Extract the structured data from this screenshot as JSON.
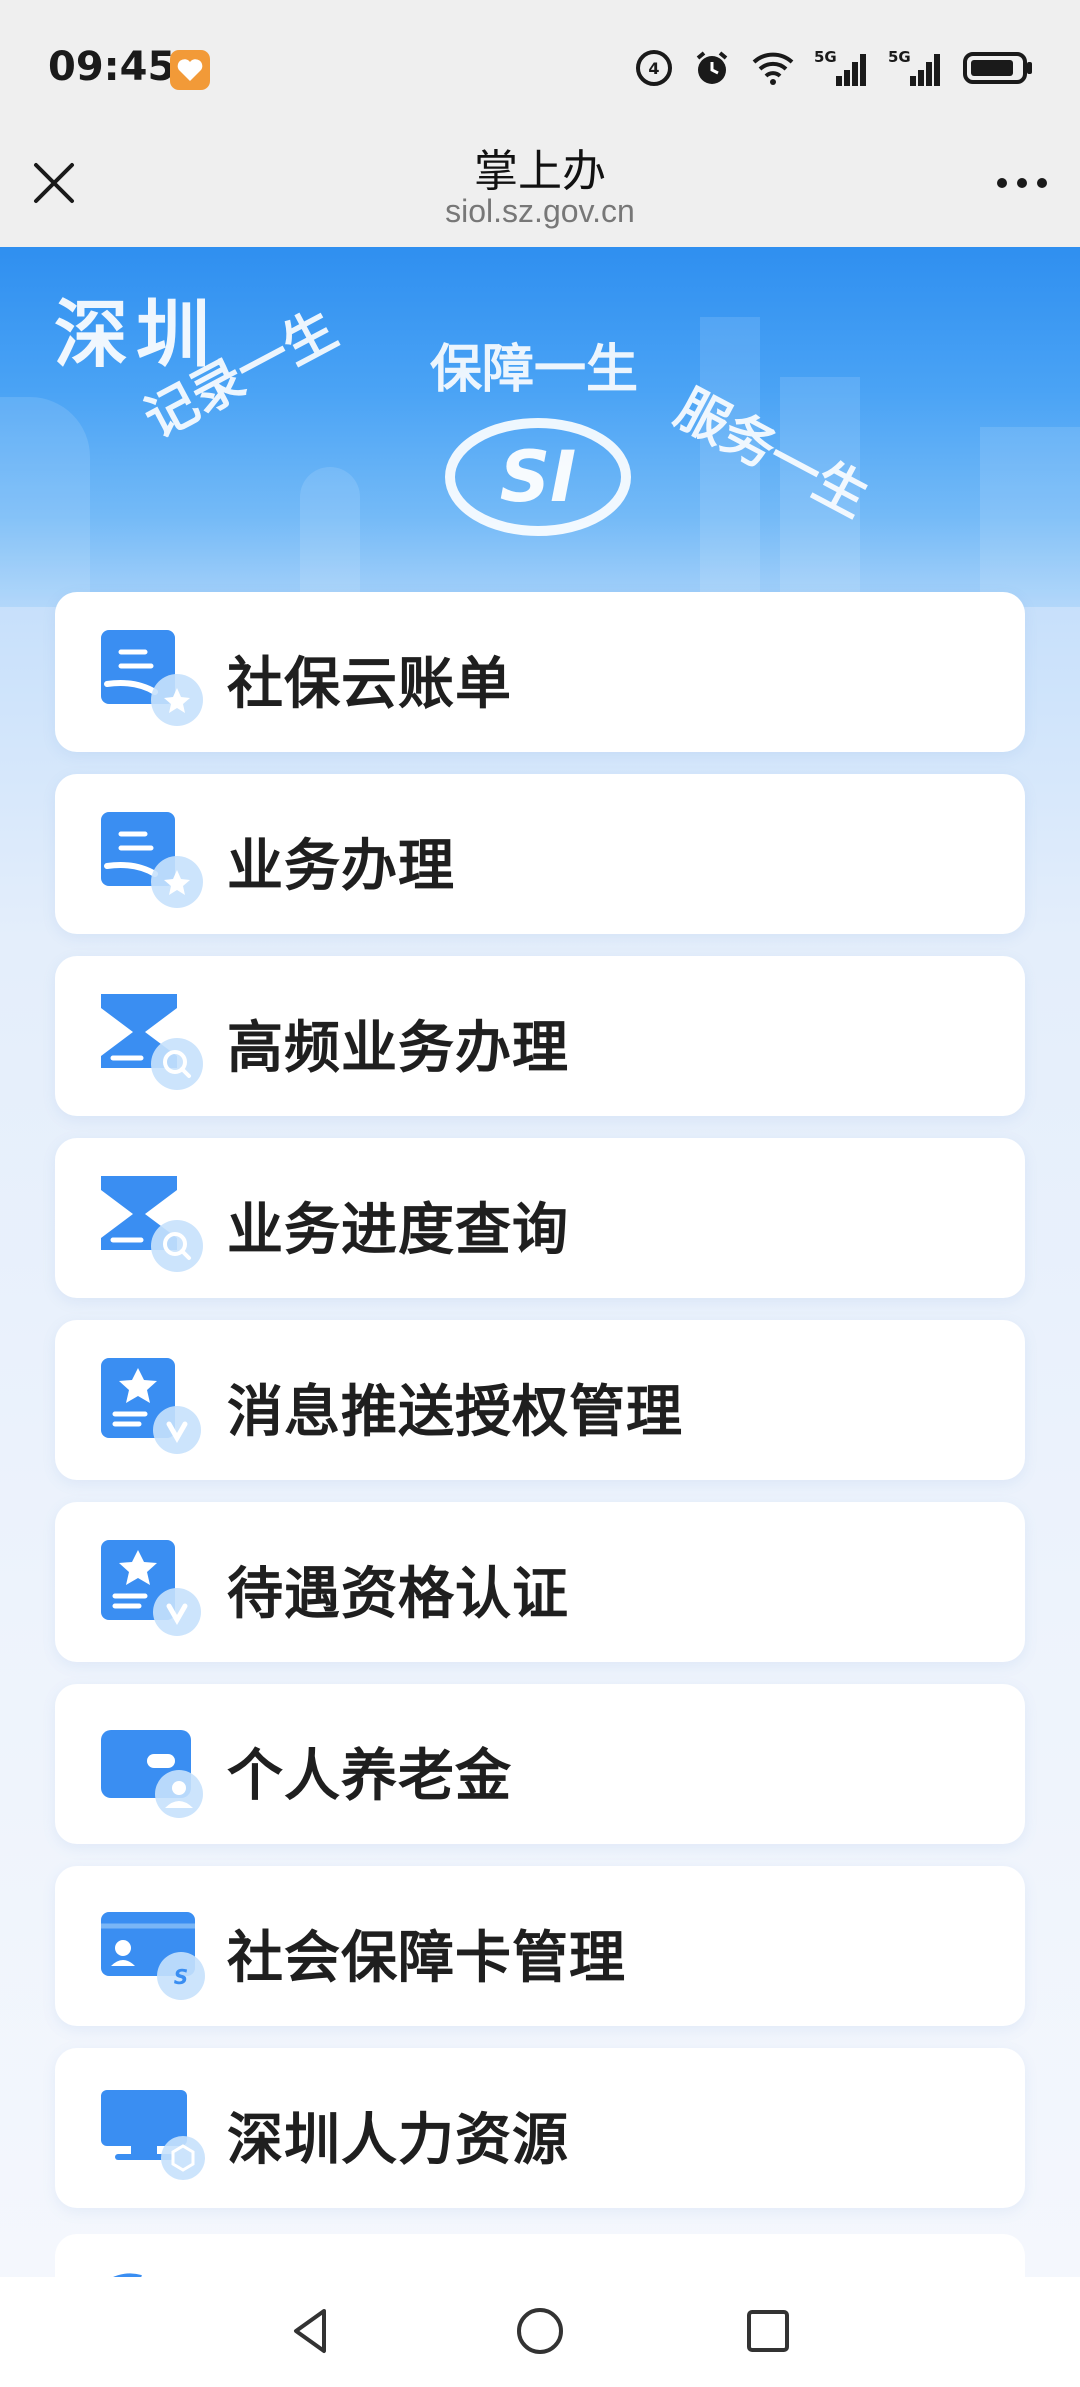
{
  "status_bar": {
    "time": "09:45",
    "icons": [
      "hd-call-icon",
      "alarm-icon",
      "wifi-icon",
      "signal-5g-icon",
      "signal-5g-icon",
      "battery-icon"
    ],
    "network_label_1": "5G",
    "network_label_2": "5G"
  },
  "title_bar": {
    "title": "掌上办",
    "url": "siol.sz.gov.cn"
  },
  "banner": {
    "city": "深圳",
    "slogans": [
      "记录一生",
      "保障一生",
      "服务一生"
    ],
    "logo_text": "SI"
  },
  "menu": {
    "items": [
      {
        "label": "社保云账单",
        "icon": "bill-hand-icon"
      },
      {
        "label": "业务办理",
        "icon": "bill-hand-icon"
      },
      {
        "label": "高频业务办理",
        "icon": "hourglass-search-icon"
      },
      {
        "label": "业务进度查询",
        "icon": "hourglass-search-icon"
      },
      {
        "label": "消息推送授权管理",
        "icon": "badge-verify-icon"
      },
      {
        "label": "待遇资格认证",
        "icon": "badge-verify-icon"
      },
      {
        "label": "个人养老金",
        "icon": "wallet-person-icon"
      },
      {
        "label": "社会保障卡管理",
        "icon": "id-card-icon"
      },
      {
        "label": "深圳人力资源",
        "icon": "monitor-cube-icon"
      }
    ]
  },
  "colors": {
    "accent": "#3a8ef2",
    "accent_light": "#9fcbfa",
    "banner_top": "#2f8ff0"
  }
}
